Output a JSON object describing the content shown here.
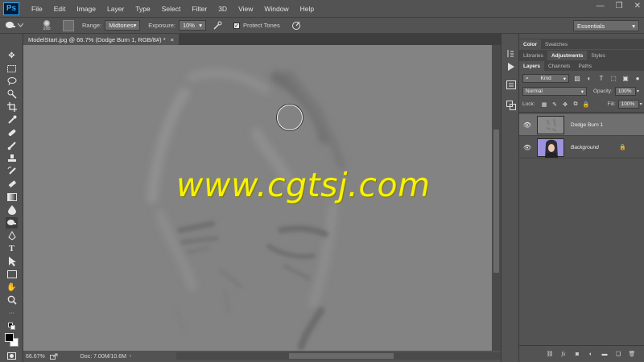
{
  "app": {
    "logo": "Ps"
  },
  "menu": [
    "File",
    "Edit",
    "Image",
    "Layer",
    "Type",
    "Select",
    "Filter",
    "3D",
    "View",
    "Window",
    "Help"
  ],
  "window_controls": [
    "—",
    "❐",
    "✕"
  ],
  "options": {
    "brush_size": "100",
    "range_label": "Range:",
    "range_value": "Midtones",
    "exposure_label": "Exposure:",
    "exposure_value": "10%",
    "protect_tones_label": "Protect Tones",
    "protect_tones_checked": true,
    "workspace": "Essentials"
  },
  "document": {
    "tab_title": "ModelStart.jpg @ 66.7% (Dodge Burn 1, RGB/8#) *",
    "close_glyph": "×",
    "zoom": "66.67%",
    "doc_info": "Doc: 7.00M/10.6M",
    "watermark": "www.cgtsj.com"
  },
  "panels": {
    "row1_tabs": [
      "Color",
      "Swatches"
    ],
    "row2_tabs": [
      "Libraries",
      "Adjustments",
      "Styles"
    ],
    "row3_tabs": [
      "Layers",
      "Channels",
      "Paths"
    ],
    "kind_label": "Kind",
    "blend_mode": "Normal",
    "opacity_label": "Opacity:",
    "opacity_value": "100%",
    "lock_label": "Lock:",
    "fill_label": "Fill:",
    "fill_value": "100%",
    "layers": [
      {
        "name": "Dodge Burn 1",
        "selected": true
      },
      {
        "name": "Background",
        "selected": false,
        "locked": true
      }
    ]
  },
  "colors": {
    "foreground": "#000000",
    "background": "#ffffff",
    "watermark": "#f7f200",
    "canvas": "#838383"
  }
}
